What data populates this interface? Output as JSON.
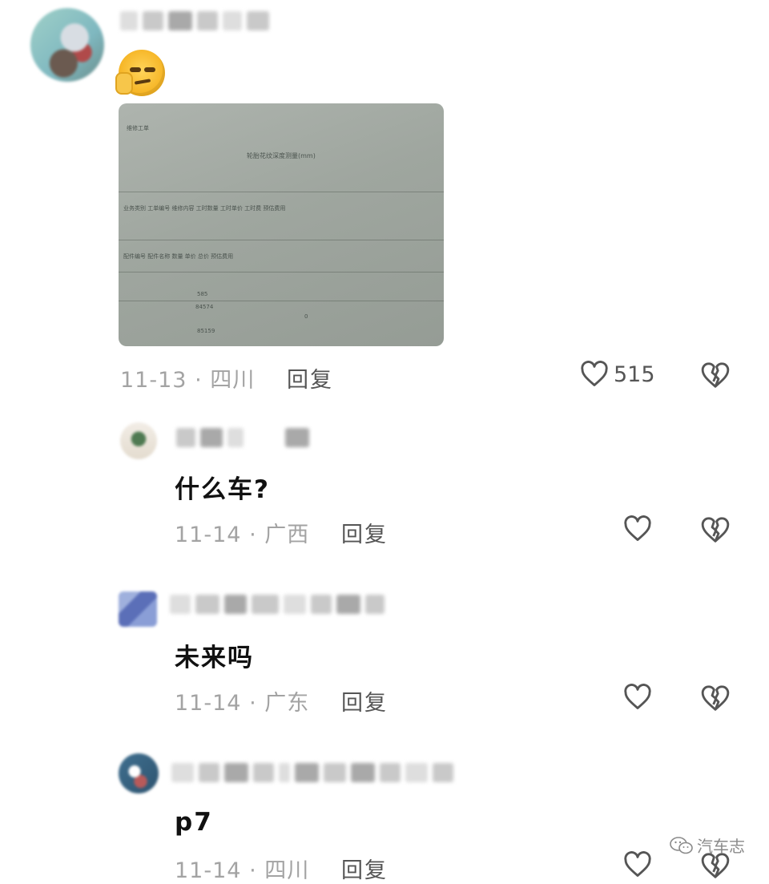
{
  "comments": [
    {
      "date": "11-13",
      "separator": "·",
      "region": "四川",
      "reply_label": "回复",
      "like_count": "515",
      "text": ""
    },
    {
      "date": "11-14",
      "separator": "·",
      "region": "广西",
      "reply_label": "回复",
      "like_count": "",
      "text": "什么车?"
    },
    {
      "date": "11-14",
      "separator": "·",
      "region": "广东",
      "reply_label": "回复",
      "like_count": "",
      "text": "未来吗"
    },
    {
      "date": "11-14",
      "separator": "·",
      "region": "四川",
      "reply_label": "回复",
      "like_count": "",
      "text": "p7"
    }
  ],
  "receipt": {
    "header": "维修工单",
    "title": "轮胎花纹深度测量(mm)",
    "row1": "业务类别  工单编号  维修内容  工时数量  工时单价  工时费  预估费用",
    "row2": "配件编号  配件名称  数量  单价  总价  预估费用",
    "numbers": [
      "585",
      "84574",
      "85159",
      "0"
    ]
  },
  "watermark": {
    "text": "汽车志",
    "icon": "wechat-icon"
  }
}
